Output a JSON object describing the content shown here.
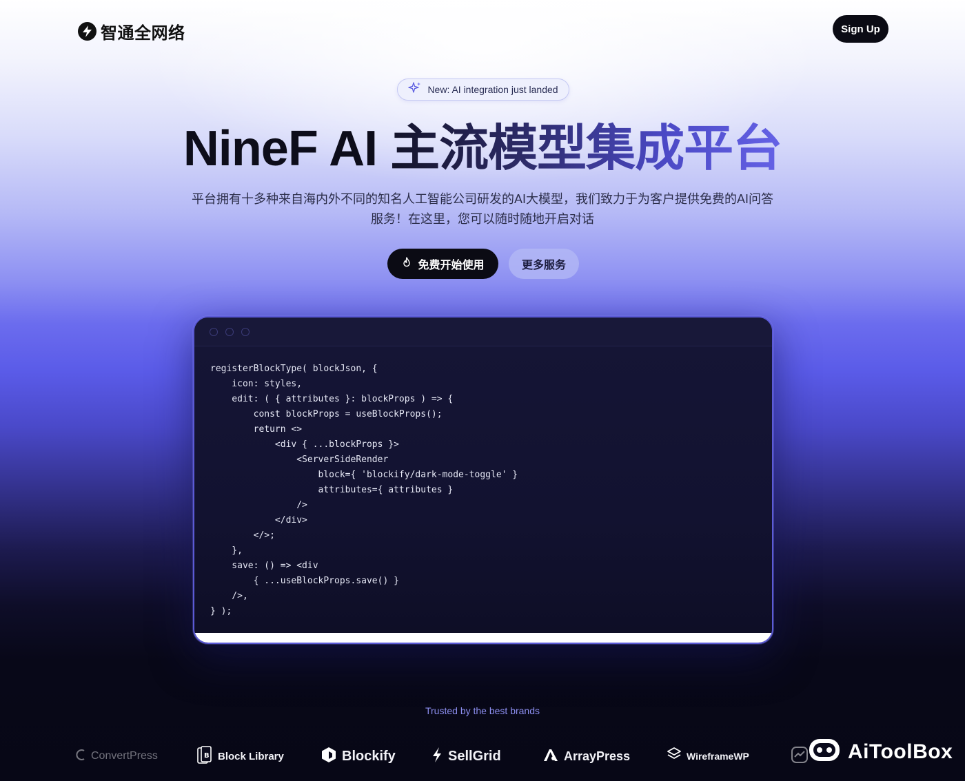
{
  "header": {
    "logo_text": "智通全网络",
    "signup_label": "Sign Up"
  },
  "badge": {
    "text": "New: AI integration just landed"
  },
  "hero": {
    "title_part1": "NineF AI ",
    "title_part2": "主流模型集成平台",
    "subtitle": "平台拥有十多种来自海内外不同的知名人工智能公司研发的AI大模型，我们致力于为客户提供免费的AI问答服务！在这里，您可以随时随地开启对话",
    "primary_cta": "免费开始使用",
    "secondary_cta": "更多服务"
  },
  "code_window": {
    "code": "registerBlockType( blockJson, {\n    icon: styles,\n    edit: ( { attributes }: blockProps ) => {\n        const blockProps = useBlockProps();\n        return <>\n            <div { ...blockProps }>\n                <ServerSideRender\n                    block={ 'blockify/dark-mode-toggle' }\n                    attributes={ attributes }\n                />\n            </div>\n        </>;\n    },\n    save: () => <div\n        { ...useBlockProps.save() }\n    />,\n} );"
  },
  "trusted": {
    "label": "Trusted by the best brands",
    "brands": [
      {
        "name": "ConvertPress",
        "icon": "convertpress-icon"
      },
      {
        "name": "Block Library",
        "icon": "block-library-icon"
      },
      {
        "name": "Blockify",
        "icon": "blockify-icon"
      },
      {
        "name": "SellGrid",
        "icon": "sellgrid-icon"
      },
      {
        "name": "ArrayPress",
        "icon": "arraypress-icon"
      },
      {
        "name": "WireframeWP",
        "icon": "wireframewp-icon"
      }
    ]
  },
  "watermark": {
    "text": "AiToolBox"
  }
}
